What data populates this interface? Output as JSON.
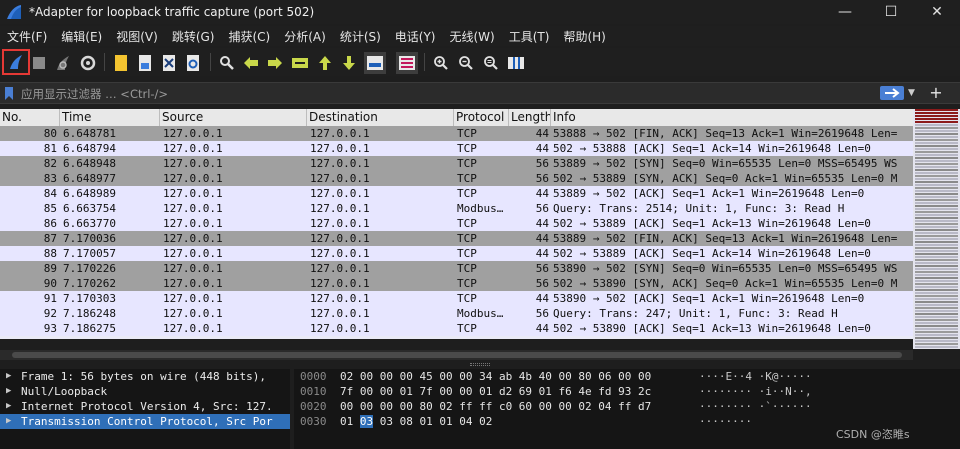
{
  "window": {
    "title": "*Adapter for loopback traffic capture (port 502)",
    "minimize": "—",
    "maximize": "☐",
    "close": "✕"
  },
  "menu": [
    "文件(F)",
    "编辑(E)",
    "视图(V)",
    "跳转(G)",
    "捕获(C)",
    "分析(A)",
    "统计(S)",
    "电话(Y)",
    "无线(W)",
    "工具(T)",
    "帮助(H)"
  ],
  "toolbar": {
    "icons": [
      "shark-fin-start-icon",
      "stop-capture-icon",
      "restart-capture-icon",
      "capture-options-icon",
      "open-file-icon",
      "save-file-icon",
      "close-file-icon",
      "reload-file-icon",
      "find-packet-icon",
      "go-back-icon",
      "go-forward-icon",
      "go-to-packet-icon",
      "go-first-icon",
      "go-last-icon",
      "auto-scroll-icon",
      "colorize-icon",
      "zoom-in-icon",
      "zoom-out-icon",
      "zoom-normal-icon",
      "resize-columns-icon"
    ],
    "accent": "#e53935"
  },
  "filter": {
    "placeholder": "应用显示过滤器 … <Ctrl-/>"
  },
  "packet_list": {
    "columns": [
      "No.",
      "Time",
      "Source",
      "Destination",
      "Protocol",
      "Length",
      "Info"
    ],
    "rows": [
      {
        "no": "80",
        "time": "6.648781",
        "src": "127.0.0.1",
        "dst": "127.0.0.1",
        "proto": "TCP",
        "len": "44",
        "info": "53888 → 502 [FIN, ACK] Seq=13 Ack=1 Win=2619648 Len=",
        "style": "fin"
      },
      {
        "no": "81",
        "time": "6.648794",
        "src": "127.0.0.1",
        "dst": "127.0.0.1",
        "proto": "TCP",
        "len": "44",
        "info": "502 → 53888 [ACK] Seq=1 Ack=14 Win=2619648 Len=0",
        "style": "ack"
      },
      {
        "no": "82",
        "time": "6.648948",
        "src": "127.0.0.1",
        "dst": "127.0.0.1",
        "proto": "TCP",
        "len": "56",
        "info": "53889 → 502 [SYN] Seq=0 Win=65535 Len=0 MSS=65495 WS",
        "style": "fin"
      },
      {
        "no": "83",
        "time": "6.648977",
        "src": "127.0.0.1",
        "dst": "127.0.0.1",
        "proto": "TCP",
        "len": "56",
        "info": "502 → 53889 [SYN, ACK] Seq=0 Ack=1 Win=65535 Len=0 M",
        "style": "fin"
      },
      {
        "no": "84",
        "time": "6.648989",
        "src": "127.0.0.1",
        "dst": "127.0.0.1",
        "proto": "TCP",
        "len": "44",
        "info": "53889 → 502 [ACK] Seq=1 Ack=1 Win=2619648 Len=0",
        "style": "ack"
      },
      {
        "no": "85",
        "time": "6.663754",
        "src": "127.0.0.1",
        "dst": "127.0.0.1",
        "proto": "Modbus…",
        "len": "56",
        "info": "  Query: Trans:  2514; Unit:   1, Func:   3: Read H",
        "style": "ack"
      },
      {
        "no": "86",
        "time": "6.663770",
        "src": "127.0.0.1",
        "dst": "127.0.0.1",
        "proto": "TCP",
        "len": "44",
        "info": "502 → 53889 [ACK] Seq=1 Ack=13 Win=2619648 Len=0",
        "style": "ack"
      },
      {
        "no": "87",
        "time": "7.170036",
        "src": "127.0.0.1",
        "dst": "127.0.0.1",
        "proto": "TCP",
        "len": "44",
        "info": "53889 → 502 [FIN, ACK] Seq=13 Ack=1 Win=2619648 Len=",
        "style": "fin"
      },
      {
        "no": "88",
        "time": "7.170057",
        "src": "127.0.0.1",
        "dst": "127.0.0.1",
        "proto": "TCP",
        "len": "44",
        "info": "502 → 53889 [ACK] Seq=1 Ack=14 Win=2619648 Len=0",
        "style": "ack"
      },
      {
        "no": "89",
        "time": "7.170226",
        "src": "127.0.0.1",
        "dst": "127.0.0.1",
        "proto": "TCP",
        "len": "56",
        "info": "53890 → 502 [SYN] Seq=0 Win=65535 Len=0 MSS=65495 WS",
        "style": "fin"
      },
      {
        "no": "90",
        "time": "7.170262",
        "src": "127.0.0.1",
        "dst": "127.0.0.1",
        "proto": "TCP",
        "len": "56",
        "info": "502 → 53890 [SYN, ACK] Seq=0 Ack=1 Win=65535 Len=0 M",
        "style": "fin"
      },
      {
        "no": "91",
        "time": "7.170303",
        "src": "127.0.0.1",
        "dst": "127.0.0.1",
        "proto": "TCP",
        "len": "44",
        "info": "53890 → 502 [ACK] Seq=1 Ack=1 Win=2619648 Len=0",
        "style": "ack"
      },
      {
        "no": "92",
        "time": "7.186248",
        "src": "127.0.0.1",
        "dst": "127.0.0.1",
        "proto": "Modbus…",
        "len": "56",
        "info": "  Query: Trans:   247; Unit:   1, Func:   3: Read H",
        "style": "ack"
      },
      {
        "no": "93",
        "time": "7.186275",
        "src": "127.0.0.1",
        "dst": "127.0.0.1",
        "proto": "TCP",
        "len": "44",
        "info": "502 → 53890 [ACK] Seq=1 Ack=13 Win=2619648 Len=0",
        "style": "ack"
      }
    ]
  },
  "details": [
    {
      "text": "Frame 1: 56 bytes on wire (448 bits),",
      "selected": false
    },
    {
      "text": "Null/Loopback",
      "selected": false
    },
    {
      "text": "Internet Protocol Version 4, Src: 127.",
      "selected": false
    },
    {
      "text": "Transmission Control Protocol, Src Por",
      "selected": true
    }
  ],
  "bytes": [
    {
      "offset": "0000",
      "hex": "02 00 00 00 45 00 00 34  ab 4b 40 00 80 06 00 00",
      "ascii": "····E··4 ·K@·····",
      "hl": -1
    },
    {
      "offset": "0010",
      "hex": "7f 00 00 01 7f 00 00 01  d2 69 01 f6 4e fd 93 2c",
      "ascii": "········ ·i··N··,",
      "hl": -1
    },
    {
      "offset": "0020",
      "hex": "00 00 00 00 80 02 ff ff  c0 60 00 00 02 04 ff d7",
      "ascii": "········ ·`······",
      "hl": -1
    },
    {
      "offset": "0030",
      "hex": "01 03 03 08 01 01 04 02",
      "ascii": "········",
      "hl": 1
    }
  ],
  "watermark": "CSDN @恣睢s",
  "colors": {
    "fin_row": "#a0a0a0",
    "ack_row": "#e7e6ff",
    "selected": "#2f6fb8"
  }
}
